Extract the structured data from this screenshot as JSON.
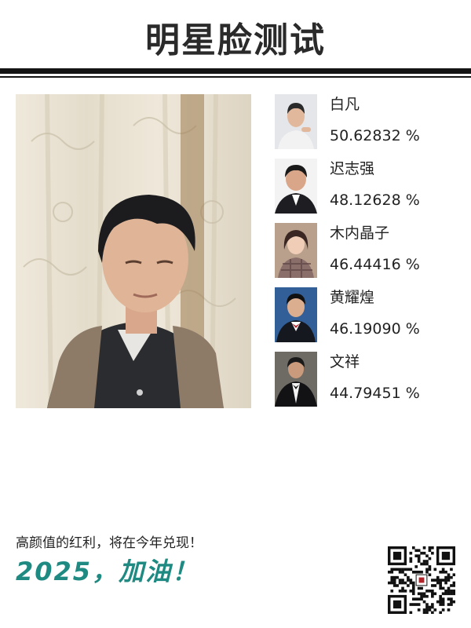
{
  "header": {
    "title": "明星脸测试"
  },
  "matches": [
    {
      "name": "白凡",
      "score": "50.62832",
      "unit": "%"
    },
    {
      "name": "迟志强",
      "score": "48.12628",
      "unit": "%"
    },
    {
      "name": "木内晶子",
      "score": "46.44416",
      "unit": "%"
    },
    {
      "name": "黄耀煌",
      "score": "46.19090",
      "unit": "%"
    },
    {
      "name": "文祥",
      "score": "44.79451",
      "unit": "%"
    }
  ],
  "footer": {
    "slogan": "高颜值的红利，将在今年兑现！",
    "cheer": "2025，加油！"
  },
  "colors": {
    "accent": "#1f8a82",
    "rule": "#141414",
    "title": "#2a2a2a"
  },
  "icons": {
    "qr": "qr-code-icon"
  }
}
